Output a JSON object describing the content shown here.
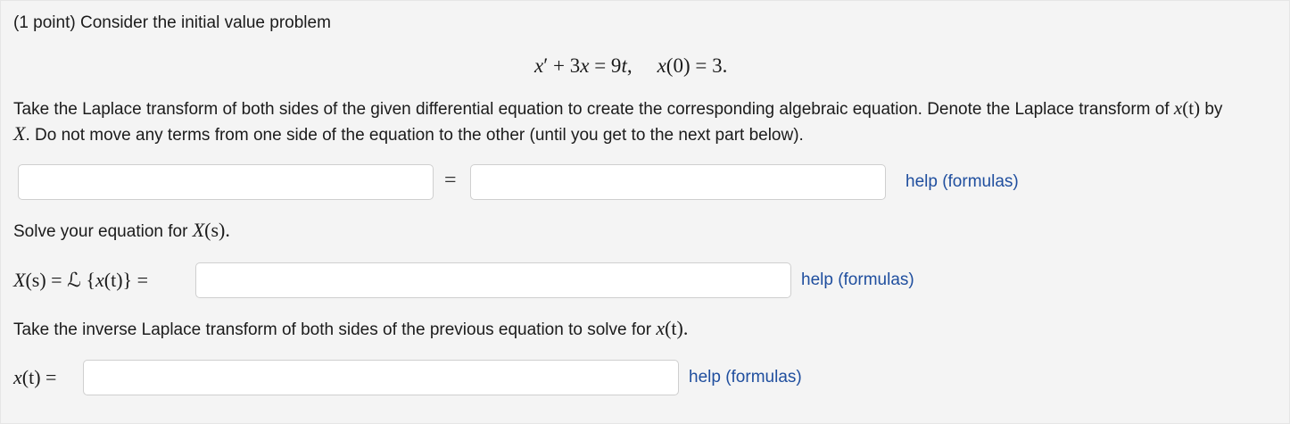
{
  "problem": {
    "intro": "(1 point) Consider the initial value problem",
    "equation": {
      "lhs_deriv": "x",
      "prime": "′",
      "plus": " + 3",
      "x_var": "x",
      "eq": " = 9",
      "t_var": "t",
      "comma": ",",
      "ic_x": "x",
      "ic_rest": "(0) = 3."
    }
  },
  "part1": {
    "instruction_a": "Take the Laplace transform of both sides of the given differential equation to create the corresponding algebraic equation. Denote the Laplace transform of",
    "math_xt": "x",
    "math_t_paren": "(t)",
    "by": "by",
    "math_X": "X",
    "instruction_b": ". Do not move any terms from one side of the equation to the other (until you get to the next part below).",
    "equals": "=",
    "lhs_value": "",
    "rhs_value": "",
    "help_label": "help (formulas)"
  },
  "part2": {
    "instruction_prefix": "Solve your equation for",
    "math_X": "X",
    "math_s": "(s).",
    "label_X": "X",
    "label_s_eq": "(s) = ℒ {",
    "label_x": "x",
    "label_t_close": "(t)} =",
    "answer_value": "",
    "help_label": "help (formulas)"
  },
  "part3": {
    "instruction_prefix": "Take the inverse Laplace transform of both sides of the previous equation to solve for",
    "math_x": "x",
    "math_t": "(t).",
    "label_x": "x",
    "label_t_eq": "(t) =",
    "answer_value": "",
    "help_label": "help (formulas)"
  }
}
